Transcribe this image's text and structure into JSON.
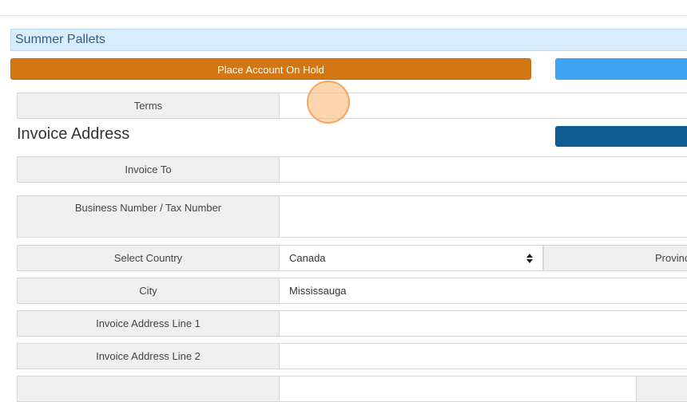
{
  "account": {
    "name": "Summer Pallets"
  },
  "actions": {
    "hold_label": "Place Account On Hold"
  },
  "colors": {
    "hold": "#d37614",
    "primary": "#3ea3f0",
    "dark": "#0f5b93",
    "header_bg": "#d9ecfb"
  },
  "terms": {
    "label": "Terms",
    "value": ""
  },
  "invoice_address": {
    "title": "Invoice Address",
    "invoice_to": {
      "label": "Invoice To",
      "value": ""
    },
    "business_number": {
      "label": "Business Number / Tax Number",
      "value": ""
    },
    "country": {
      "label": "Select Country",
      "value": "Canada",
      "caret_icon": "sort-arrows-icon"
    },
    "province": {
      "label": "Provinc"
    },
    "city": {
      "label": "City",
      "value": "Mississauga"
    },
    "line1": {
      "label": "Invoice Address Line 1",
      "value": ""
    },
    "line2": {
      "label": "Invoice Address Line 2",
      "value": ""
    }
  }
}
